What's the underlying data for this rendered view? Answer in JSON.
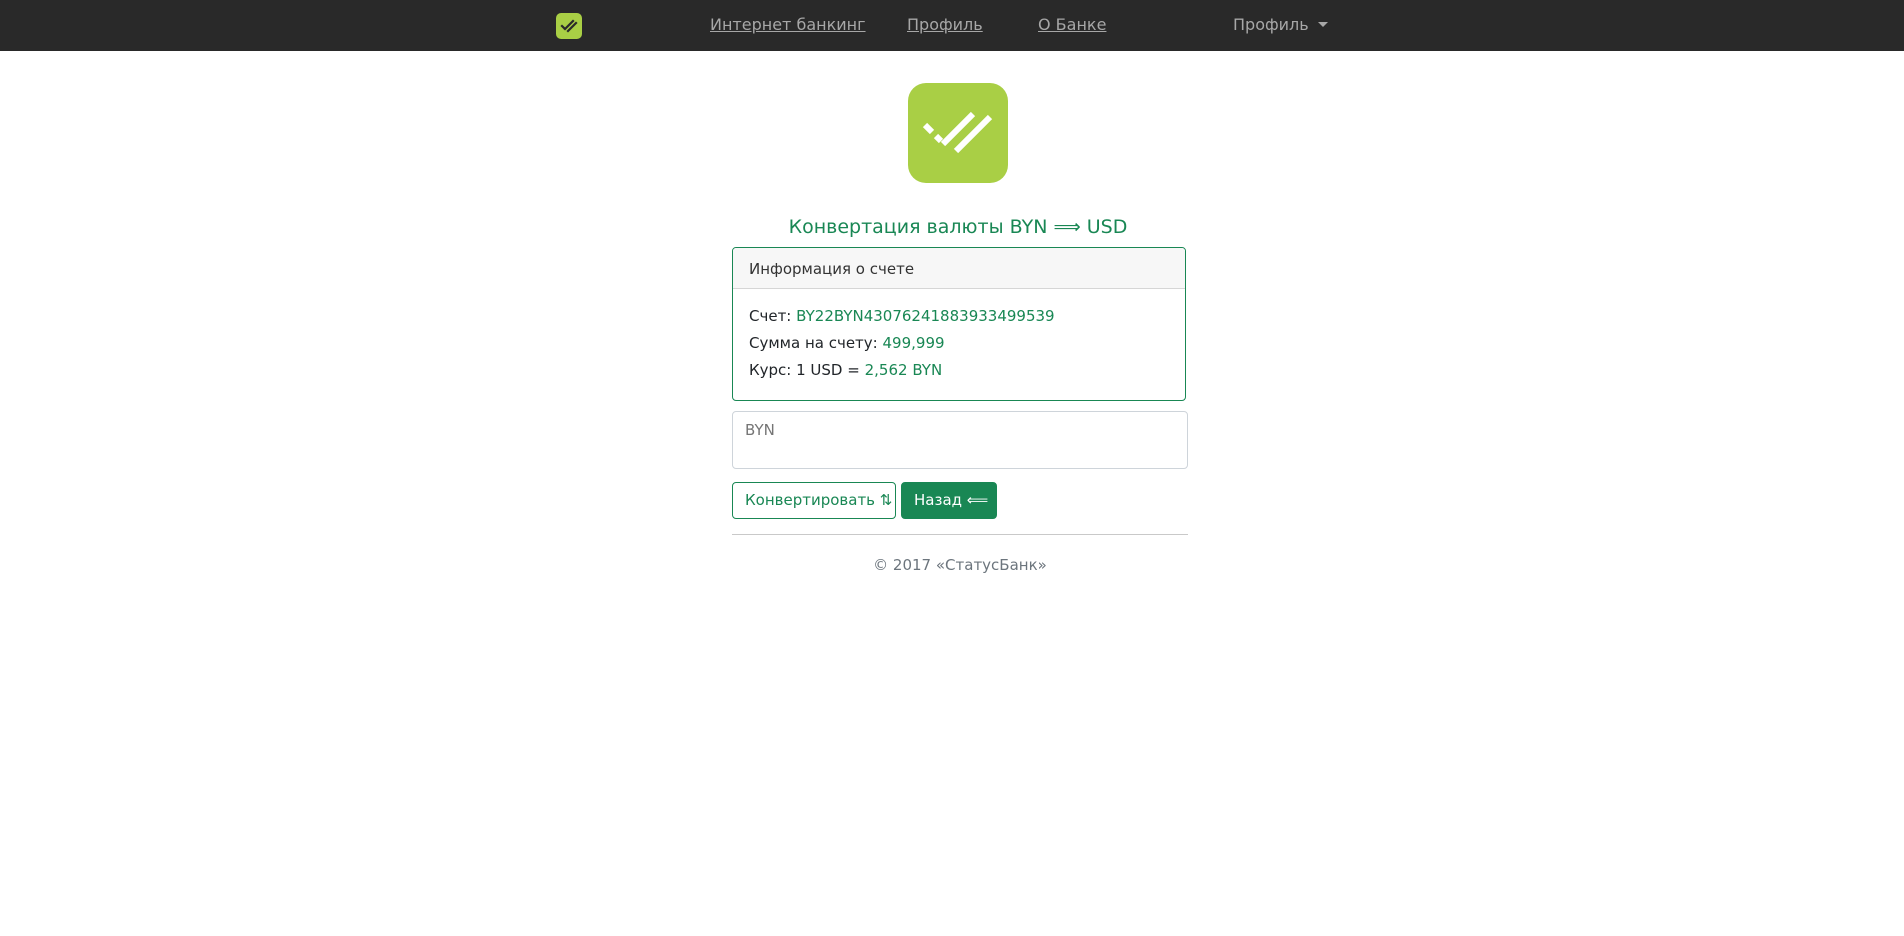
{
  "navbar": {
    "logo_icon": "double-check-icon",
    "links": [
      {
        "label": "Интернет банкинг"
      },
      {
        "label": "Профиль"
      },
      {
        "label": "О Банке"
      }
    ],
    "dropdown_label": "Профиль",
    "background": "#292929"
  },
  "hero": {
    "logo_icon": "double-check-icon",
    "brand_color": "#a9cf45"
  },
  "page": {
    "title": "Конвертация валюты BYN ⟹ USD",
    "accent_color": "#198754"
  },
  "card": {
    "header": "Информация о счете",
    "account_label": "Счет:",
    "account_value": "BY22BYN43076241883933499539",
    "balance_label": "Сумма на счету:",
    "balance_value": "499,999",
    "rate_label": "Курс: 1 USD =",
    "rate_value": "2,562 BYN"
  },
  "form": {
    "amount_placeholder": "BYN",
    "amount_value": "",
    "convert_button": "Конвертировать ⇅",
    "back_button": "Назад ⟸"
  },
  "footer": {
    "text": "© 2017 «СтатусБанк»"
  }
}
